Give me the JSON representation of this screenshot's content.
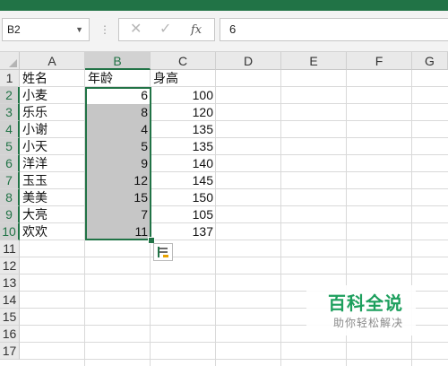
{
  "colors": {
    "brand": "#217346",
    "selection_fill": "#c6c6c6",
    "watermark_green": "#1d9f5d"
  },
  "formula_bar": {
    "name_box": "B2",
    "dots_icon": "⋮",
    "cancel_icon": "✕",
    "enter_icon": "✓",
    "fx_label": "fx",
    "formula_value": "6"
  },
  "columns": [
    "A",
    "B",
    "C",
    "D",
    "E",
    "F",
    "G"
  ],
  "rows": [
    "1",
    "2",
    "3",
    "4",
    "5",
    "6",
    "7",
    "8",
    "9",
    "10",
    "11",
    "12",
    "13",
    "14",
    "15",
    "16",
    "17"
  ],
  "table": {
    "header": {
      "name": "姓名",
      "age": "年龄",
      "height": "身高"
    },
    "records": [
      {
        "name": "小麦",
        "age": "6",
        "height": "100"
      },
      {
        "name": "乐乐",
        "age": "8",
        "height": "120"
      },
      {
        "name": "小谢",
        "age": "4",
        "height": "135"
      },
      {
        "name": "小天",
        "age": "5",
        "height": "135"
      },
      {
        "name": "洋洋",
        "age": "9",
        "height": "140"
      },
      {
        "name": "玉玉",
        "age": "12",
        "height": "145"
      },
      {
        "name": "美美",
        "age": "15",
        "height": "150"
      },
      {
        "name": "大亮",
        "age": "7",
        "height": "105"
      },
      {
        "name": "欢欢",
        "age": "11",
        "height": "137"
      }
    ]
  },
  "selection": {
    "range": "B2:B10",
    "active_cell": "B2"
  },
  "quick_analysis_icon": "quick-analysis-icon",
  "watermark": {
    "title": "百科全说",
    "subtitle": "助你轻松解决"
  }
}
